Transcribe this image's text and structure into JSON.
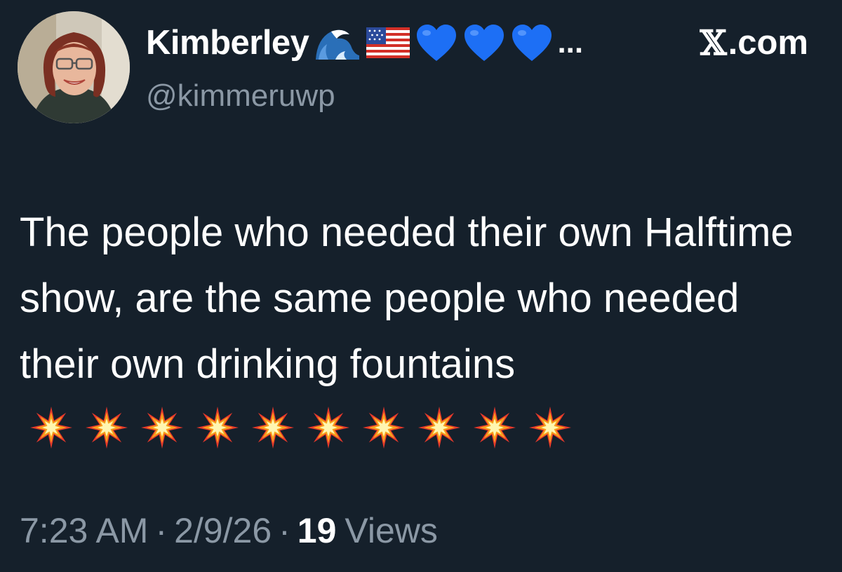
{
  "tweet": {
    "author": {
      "display_name": "Kimberley",
      "name_emojis": [
        "wave-icon",
        "us-flag-icon",
        "blue-heart-icon",
        "blue-heart-icon",
        "blue-heart-icon"
      ],
      "ellipsis": "...",
      "handle": "@kimmeruwp"
    },
    "site": {
      "x_glyph": "𝕏",
      "label": ".com"
    },
    "text": "The people who needed their own Halftime show, are the same people who needed their own drinking fountains",
    "text_emoji": "collision-icon",
    "text_emoji_count": 10,
    "meta": {
      "time": "7:23 AM",
      "separator": "·",
      "date": "2/9/26",
      "views_count": "19",
      "views_label": "Views"
    }
  },
  "colors": {
    "background": "#15202b",
    "text_primary": "#ffffff",
    "text_secondary": "#8b98a5",
    "heart_blue": "#1d6ff5"
  }
}
